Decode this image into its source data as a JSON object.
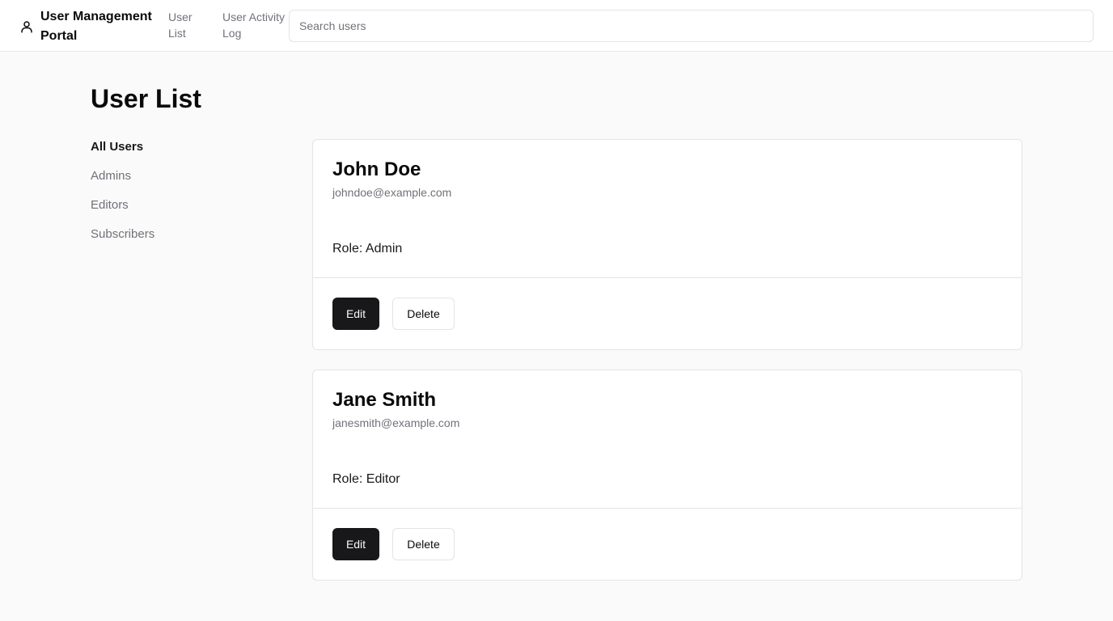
{
  "header": {
    "brand_icon": "user-icon",
    "brand_title": "User Management Portal",
    "nav": [
      {
        "label": "User List"
      },
      {
        "label": "User Activity Log"
      }
    ],
    "search_placeholder": "Search users"
  },
  "main": {
    "title": "User List"
  },
  "sidebar": {
    "items": [
      {
        "label": "All Users",
        "active": true
      },
      {
        "label": "Admins",
        "active": false
      },
      {
        "label": "Editors",
        "active": false
      },
      {
        "label": "Subscribers",
        "active": false
      }
    ]
  },
  "users": [
    {
      "name": "John Doe",
      "email": "johndoe@example.com",
      "role": "Role: Admin",
      "edit_label": "Edit",
      "delete_label": "Delete"
    },
    {
      "name": "Jane Smith",
      "email": "janesmith@example.com",
      "role": "Role: Editor",
      "edit_label": "Edit",
      "delete_label": "Delete"
    }
  ],
  "colors": {
    "primary_button": "#18181b",
    "muted_text": "#71717a",
    "border": "#e4e4e7",
    "page_background": "#f9faf9"
  }
}
